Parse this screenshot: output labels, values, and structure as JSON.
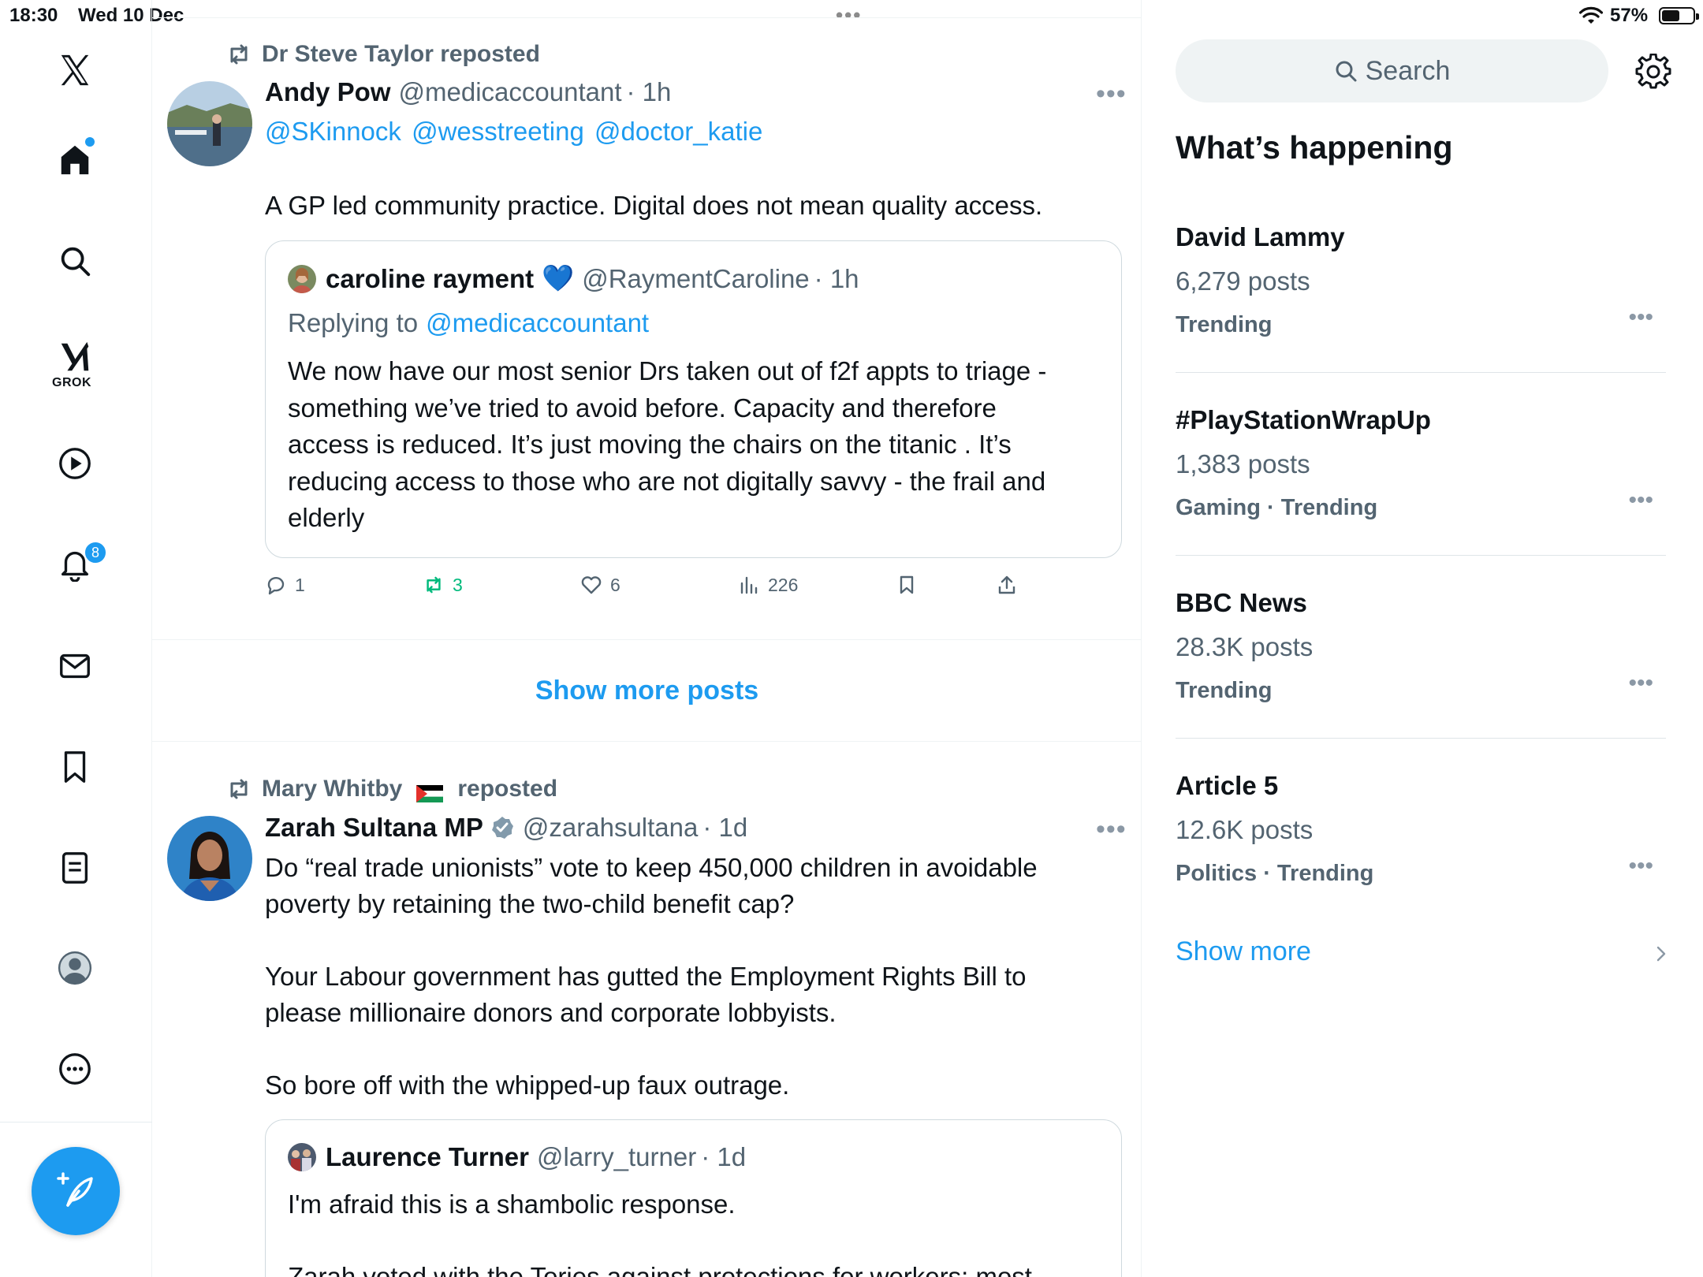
{
  "status_bar": {
    "time": "18:30",
    "date": "Wed 10 Dec",
    "battery": "57%",
    "battery_level": 0.57
  },
  "nav": {
    "grok_label": "GROK",
    "notifications_badge": "8"
  },
  "feed": {
    "show_more_posts": "Show more posts",
    "tweet1": {
      "reposted_by": "Dr Steve Taylor reposted",
      "name": "Andy Pow",
      "handle": "@medicaccountant",
      "time": "· 1h",
      "mentions": [
        "@SKinnock",
        "@wesstreeting",
        "@doctor_katie"
      ],
      "text": "A GP led community practice. Digital does not mean quality access.",
      "quote": {
        "name": "caroline rayment",
        "emoji": "💙",
        "handle": "@RaymentCaroline",
        "time": "· 1h",
        "replying_prefix": "Replying to",
        "replying_to": "@medicaccountant",
        "text_lines": [
          "We now have our most senior Drs taken out of f2f appts to triage -",
          "something we’ve tried to avoid before. Capacity and therefore",
          "access is reduced. It’s just moving the chairs on the titanic . It’s",
          "reducing access to those who are not digitally savvy - the frail and",
          "elderly"
        ]
      },
      "actions": {
        "replies": "1",
        "reposts": "3",
        "likes": "6",
        "views": "226"
      }
    },
    "tweet2": {
      "reposted_by_name": "Mary Whitby",
      "reposted_suffix": "reposted",
      "name": "Zarah Sultana MP",
      "handle": "@zarahsultana",
      "time": "· 1d",
      "text": "Do “real trade unionists” vote to keep 450,000 children in avoidable\npoverty by retaining the two-child benefit cap?\n\nYour Labour government has gutted the Employment Rights Bill to\nplease millionaire donors and corporate lobbyists.\n\nSo bore off with the whipped-up faux outrage.",
      "quote": {
        "name": "Laurence Turner",
        "handle": "@larry_turner",
        "time": "· 1d",
        "text": "I'm afraid this is a shambolic response.",
        "text2": "Zarah voted with the Tories against protections for workers: most"
      }
    }
  },
  "sidebar": {
    "search_placeholder": "Search",
    "title": "What’s happening",
    "trends": [
      {
        "name": "David Lammy",
        "count": "6,279 posts",
        "meta": "Trending"
      },
      {
        "name": "#PlayStationWrapUp",
        "count": "1,383 posts",
        "meta": "Gaming · Trending"
      },
      {
        "name": "BBC News",
        "count": "28.3K posts",
        "meta": "Trending"
      },
      {
        "name": "Article 5",
        "count": "12.6K posts",
        "meta": "Politics · Trending"
      }
    ],
    "show_more": "Show more"
  },
  "colors": {
    "accent": "#1d9bf0",
    "muted": "#536471",
    "repost_green": "#00ba7c"
  }
}
